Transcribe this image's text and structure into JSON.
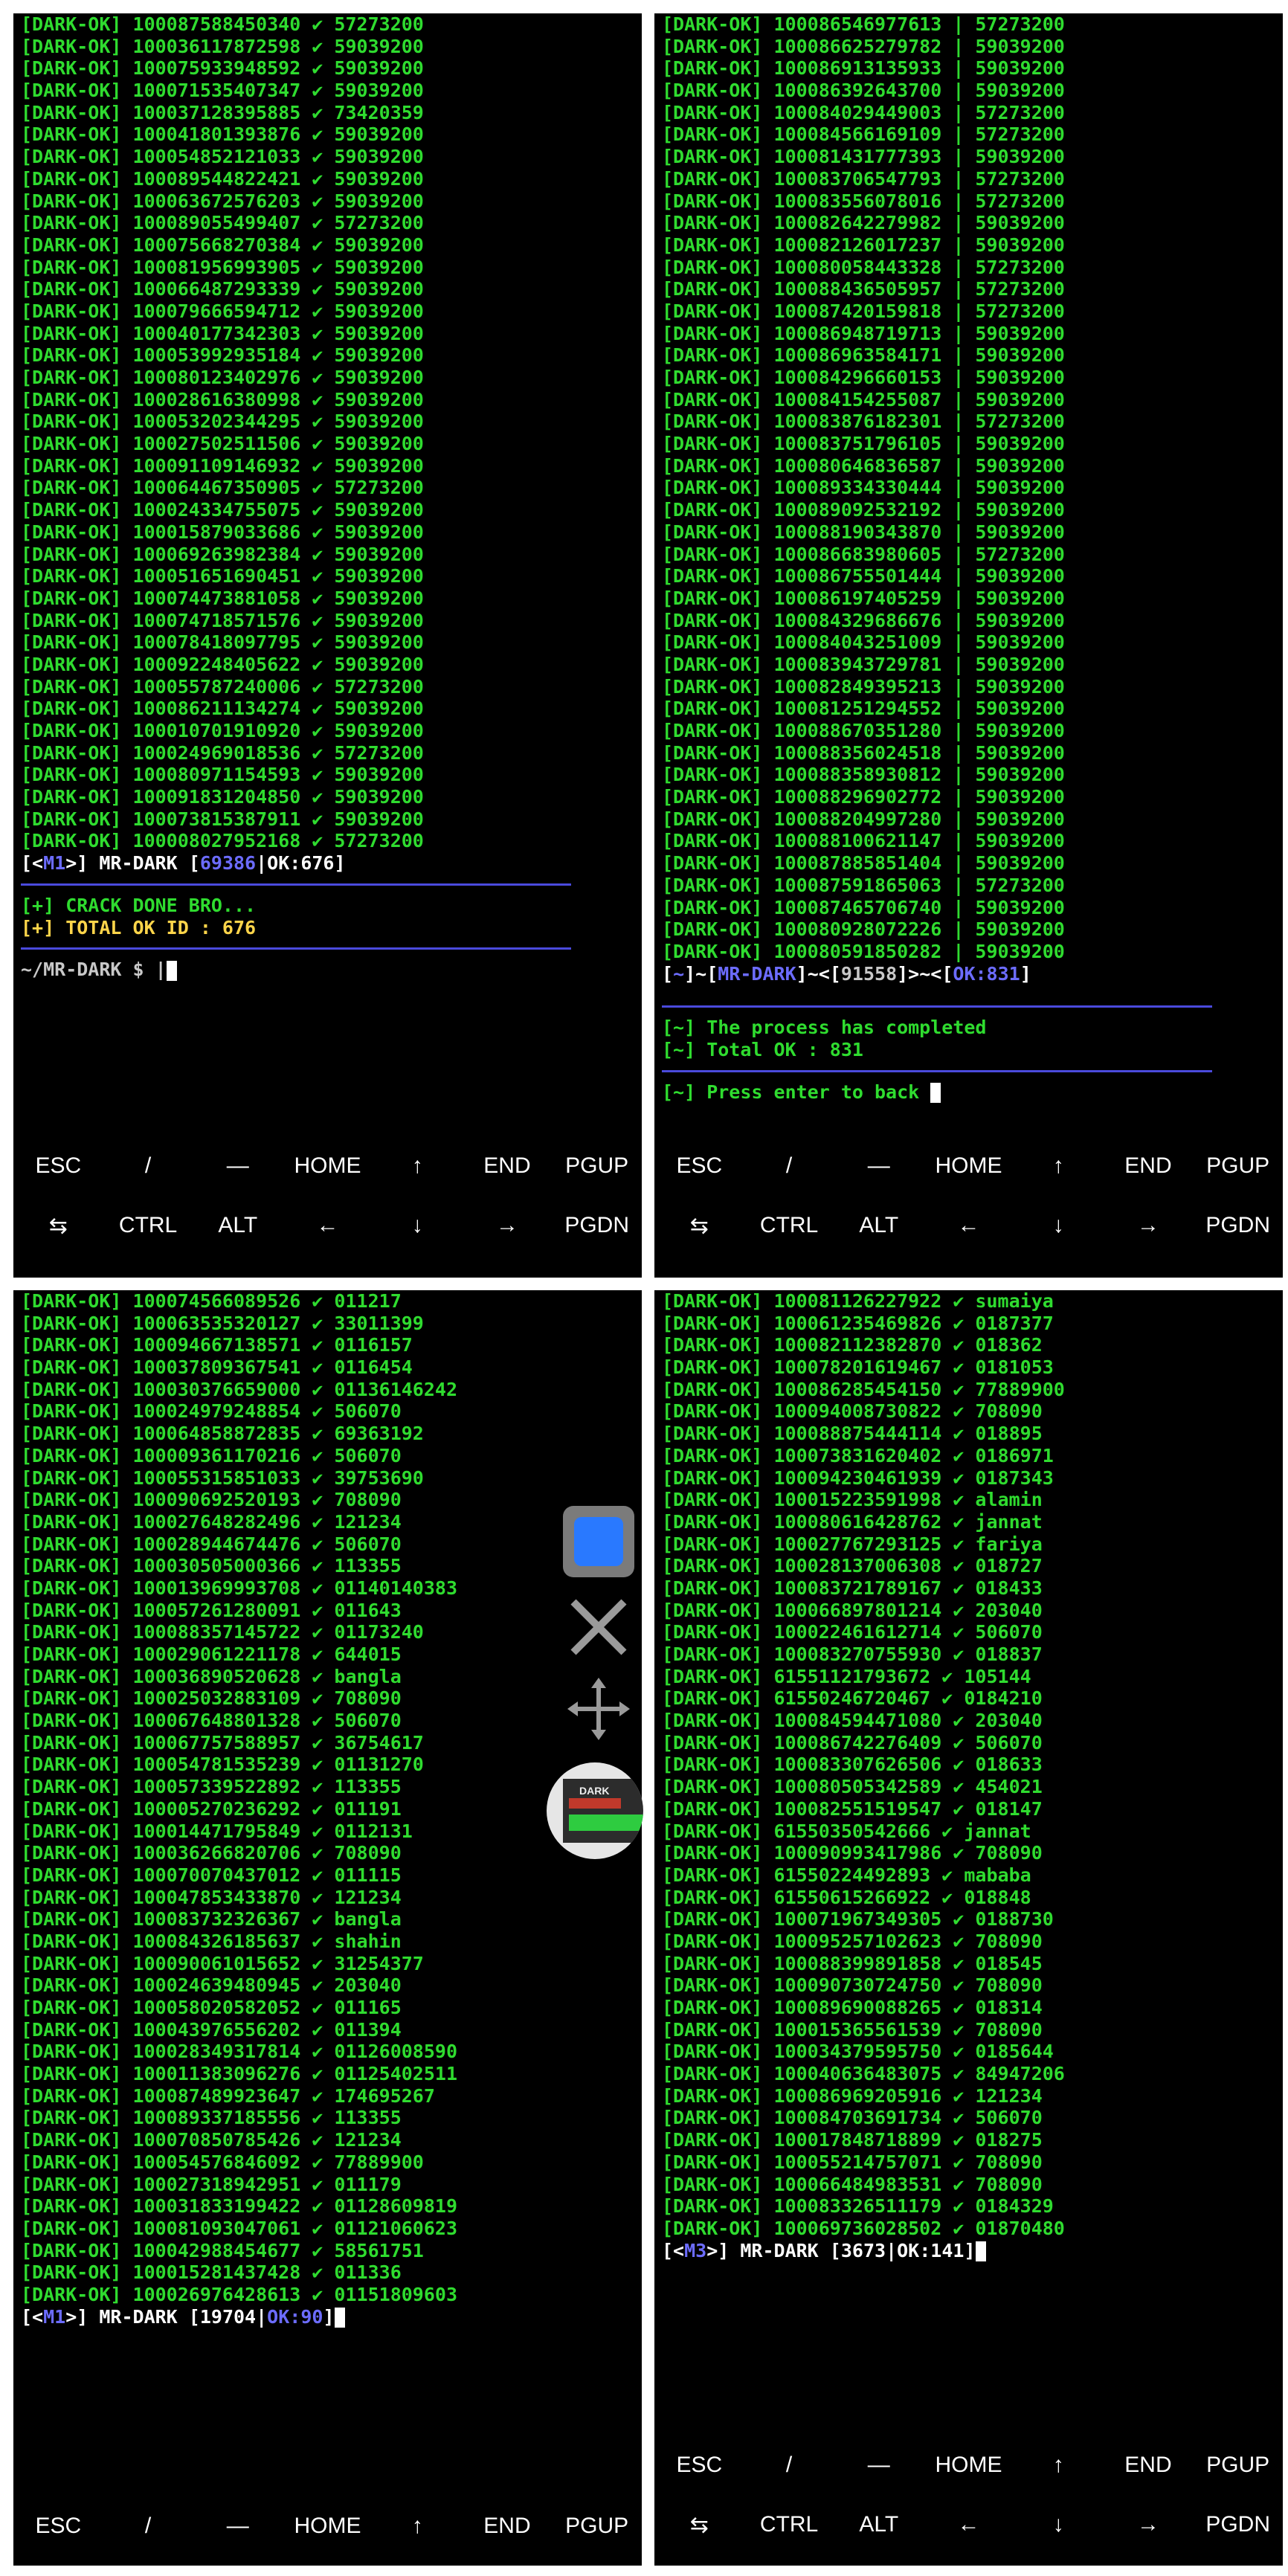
{
  "panel1": {
    "lines": [
      "[DARK-OK] 100087588450340 ✔ 57273200",
      "[DARK-OK] 100036117872598 ✔ 59039200",
      "[DARK-OK] 100075933948592 ✔ 59039200",
      "[DARK-OK] 100071535407347 ✔ 59039200",
      "[DARK-OK] 100037128395885 ✔ 73420359",
      "[DARK-OK] 100041801393876 ✔ 59039200",
      "[DARK-OK] 100054852121033 ✔ 59039200",
      "[DARK-OK] 100089544822421 ✔ 59039200",
      "[DARK-OK] 100063672576203 ✔ 59039200",
      "[DARK-OK] 100089055499407 ✔ 57273200",
      "[DARK-OK] 100075668270384 ✔ 59039200",
      "[DARK-OK] 100081956993905 ✔ 59039200",
      "[DARK-OK] 100066487293339 ✔ 59039200",
      "[DARK-OK] 100079666594712 ✔ 59039200",
      "[DARK-OK] 100040177342303 ✔ 59039200",
      "[DARK-OK] 100053992935184 ✔ 59039200",
      "[DARK-OK] 100080123402976 ✔ 59039200",
      "[DARK-OK] 100028616380998 ✔ 59039200",
      "[DARK-OK] 100053202344295 ✔ 59039200",
      "[DARK-OK] 100027502511506 ✔ 59039200",
      "[DARK-OK] 100091109146932 ✔ 59039200",
      "[DARK-OK] 100064467350905 ✔ 57273200",
      "[DARK-OK] 100024334755075 ✔ 59039200",
      "[DARK-OK] 100015879033686 ✔ 59039200",
      "[DARK-OK] 100069263982384 ✔ 59039200",
      "[DARK-OK] 100051651690451 ✔ 59039200",
      "[DARK-OK] 100074473881058 ✔ 59039200",
      "[DARK-OK] 100074718571576 ✔ 59039200",
      "[DARK-OK] 100078418097795 ✔ 59039200",
      "[DARK-OK] 100092248405622 ✔ 59039200",
      "[DARK-OK] 100055787240006 ✔ 57273200",
      "[DARK-OK] 100086211134274 ✔ 59039200",
      "[DARK-OK] 100010701910920 ✔ 59039200",
      "[DARK-OK] 100024969018536 ✔ 57273200",
      "[DARK-OK] 100080971154593 ✔ 59039200",
      "[DARK-OK] 100091831204850 ✔ 59039200",
      "[DARK-OK] 100073815387911 ✔ 59039200",
      "[DARK-OK] 100008027952168 ✔ 57273200"
    ],
    "status": {
      "prefix": "[<",
      "m": "M1",
      "mid": ">] MR-DARK [",
      "count": "69386",
      "pipe": "|",
      "ok": "OK:676",
      "end": "]"
    },
    "done1": "[+] CRACK DONE BRO...",
    "done2": "[+] TOTAL OK ID : 676",
    "prompt": "~/MR-DARK $ |"
  },
  "panel2": {
    "lines": [
      "[DARK-OK] 100086546977613 | 57273200",
      "[DARK-OK] 100086625279782 | 59039200",
      "[DARK-OK] 100086913135933 | 59039200",
      "[DARK-OK] 100086392643700 | 59039200",
      "[DARK-OK] 100084029449003 | 57273200",
      "[DARK-OK] 100084566169109 | 57273200",
      "[DARK-OK] 100081431777393 | 59039200",
      "[DARK-OK] 100083706547793 | 57273200",
      "[DARK-OK] 100083556078016 | 57273200",
      "[DARK-OK] 100082642279982 | 59039200",
      "[DARK-OK] 100082126017237 | 59039200",
      "[DARK-OK] 100080058443328 | 57273200",
      "[DARK-OK] 100088436505957 | 57273200",
      "[DARK-OK] 100087420159818 | 57273200",
      "[DARK-OK] 100086948719713 | 59039200",
      "[DARK-OK] 100086963584171 | 59039200",
      "[DARK-OK] 100084296660153 | 59039200",
      "[DARK-OK] 100084154255087 | 59039200",
      "[DARK-OK] 100083876182301 | 57273200",
      "[DARK-OK] 100083751796105 | 59039200",
      "[DARK-OK] 100080646836587 | 59039200",
      "[DARK-OK] 100089334330444 | 59039200",
      "[DARK-OK] 100089092532192 | 59039200",
      "[DARK-OK] 100088190343870 | 59039200",
      "[DARK-OK] 100086683980605 | 57273200",
      "[DARK-OK] 100086755501444 | 59039200",
      "[DARK-OK] 100086197405259 | 59039200",
      "[DARK-OK] 100084329686676 | 59039200",
      "[DARK-OK] 100084043251009 | 59039200",
      "[DARK-OK] 100083943729781 | 59039200",
      "[DARK-OK] 100082849395213 | 59039200",
      "[DARK-OK] 100081251294552 | 59039200",
      "[DARK-OK] 100088670351280 | 59039200",
      "[DARK-OK] 100088356024518 | 59039200",
      "[DARK-OK] 100088358930812 | 59039200",
      "[DARK-OK] 100088296902772 | 59039200",
      "[DARK-OK] 100088204997280 | 59039200",
      "[DARK-OK] 100088100621147 | 59039200",
      "[DARK-OK] 100087885851404 | 59039200",
      "[DARK-OK] 100087591865063 | 57273200",
      "[DARK-OK] 100087465706740 | 59039200",
      "[DARK-OK] 100080928072226 | 59039200",
      "[DARK-OK] 100080591850282 | 59039200"
    ],
    "status": {
      "a": "[",
      "b": "~",
      "c": "]~[",
      "d": "MR-DARK",
      "e": "]~<[",
      "count": "91558",
      "f": "]>~<[",
      "ok": "OK:831",
      "g": "]"
    },
    "done1": "[~] The process has completed",
    "done2": "[~] Total OK : 831",
    "prompt": "[~] Press enter to back "
  },
  "panel3": {
    "lines": [
      "[DARK-OK] 100074566089526 ✔ 011217",
      "[DARK-OK] 100063535320127 ✔ 33011399",
      "[DARK-OK] 100094667138571 ✔ 0116157",
      "[DARK-OK] 100037809367541 ✔ 0116454",
      "[DARK-OK] 100030376659000 ✔ 01136146242",
      "[DARK-OK] 100024979248854 ✔ 506070",
      "[DARK-OK] 100064858872835 ✔ 69363192",
      "[DARK-OK] 100009361170216 ✔ 506070",
      "[DARK-OK] 100055315851033 ✔ 39753690",
      "[DARK-OK] 100090692520193 ✔ 708090",
      "[DARK-OK] 100027648282496 ✔ 121234",
      "[DARK-OK] 100028944674476 ✔ 506070",
      "[DARK-OK] 100030505000366 ✔ 113355",
      "[DARK-OK] 100013969993708 ✔ 01140140383",
      "[DARK-OK] 100057261280091 ✔ 011643",
      "[DARK-OK] 100088357145722 ✔ 01173240",
      "[DARK-OK] 100029061221178 ✔ 644015",
      "[DARK-OK] 100036890520628 ✔ bangla",
      "[DARK-OK] 100025032883109 ✔ 708090",
      "[DARK-OK] 100067648801328 ✔ 506070",
      "[DARK-OK] 100067757588957 ✔ 36754617",
      "[DARK-OK] 100054781535239 ✔ 01131270",
      "[DARK-OK] 100057339522892 ✔ 113355",
      "[DARK-OK] 100005270236292 ✔ 011191",
      "[DARK-OK] 100014471795849 ✔ 0112131",
      "[DARK-OK] 100036266820706 ✔ 708090",
      "[DARK-OK] 100070070437012 ✔ 011115",
      "[DARK-OK] 100047853433870 ✔ 121234",
      "[DARK-OK] 100083732326367 ✔ bangla",
      "[DARK-OK] 100084326185637 ✔ shahin",
      "[DARK-OK] 100090061015652 ✔ 31254377",
      "[DARK-OK] 100024639480945 ✔ 203040",
      "[DARK-OK] 100058020582052 ✔ 011165",
      "[DARK-OK] 100043976556202 ✔ 011394",
      "[DARK-OK] 100028349317814 ✔ 01126008590",
      "[DARK-OK] 100011383096276 ✔ 01125402511",
      "[DARK-OK] 100087489923647 ✔ 174695267",
      "[DARK-OK] 100089337185556 ✔ 113355",
      "[DARK-OK] 100070850785426 ✔ 121234",
      "[DARK-OK] 100054576846092 ✔ 77889900",
      "[DARK-OK] 100027318942951 ✔ 011179",
      "[DARK-OK] 100031833199422 ✔ 01128609819",
      "[DARK-OK] 100081093047061 ✔ 01121060623",
      "[DARK-OK] 100042988454677 ✔ 58561751",
      "[DARK-OK] 100015281437428 ✔ 011336",
      "[DARK-OK] 100026976428613 ✔ 01151809603"
    ],
    "status": {
      "prefix": "[<",
      "m": "M1",
      "mid": ">] MR-DARK [",
      "count": "19704",
      "pipe": "|",
      "ok": "OK:90",
      "end": "]"
    }
  },
  "panel4": {
    "lines": [
      "[DARK-OK] 100081126227922 ✔ sumaiya",
      "[DARK-OK] 100061235469826 ✔ 0187377",
      "[DARK-OK] 100082112382870 ✔ 018362",
      "[DARK-OK] 100078201619467 ✔ 0181053",
      "[DARK-OK] 100086285454150 ✔ 77889900",
      "[DARK-OK] 100094008730822 ✔ 708090",
      "[DARK-OK] 100088875444114 ✔ 018895",
      "[DARK-OK] 100073831620402 ✔ 0186971",
      "[DARK-OK] 100094230461939 ✔ 0187343",
      "[DARK-OK] 100015223591998 ✔ alamin",
      "[DARK-OK] 100080616428762 ✔ jannat",
      "[DARK-OK] 100027767293125 ✔ fariya",
      "[DARK-OK] 100028137006308 ✔ 018727",
      "[DARK-OK] 100083721789167 ✔ 018433",
      "[DARK-OK] 100066897801214 ✔ 203040",
      "[DARK-OK] 100022461612714 ✔ 506070",
      "[DARK-OK] 100083270755930 ✔ 018837",
      "[DARK-OK] 61551121793672 ✔ 105144",
      "[DARK-OK] 61550246720467 ✔ 0184210",
      "[DARK-OK] 100084594471080 ✔ 203040",
      "[DARK-OK] 100086742276409 ✔ 506070",
      "[DARK-OK] 100083307626506 ✔ 018633",
      "[DARK-OK] 100080505342589 ✔ 454021",
      "[DARK-OK] 100082551519547 ✔ 018147",
      "[DARK-OK] 61550350542666 ✔ jannat",
      "[DARK-OK] 100090993417986 ✔ 708090",
      "[DARK-OK] 61550224492893 ✔ mababa",
      "[DARK-OK] 61550615266922 ✔ 018848",
      "[DARK-OK] 100071967349305 ✔ 0188730",
      "[DARK-OK] 100095257102623 ✔ 708090",
      "[DARK-OK] 100088399891858 ✔ 018545",
      "[DARK-OK] 100090730724750 ✔ 708090",
      "[DARK-OK] 100089690088265 ✔ 018314",
      "[DARK-OK] 100015365561539 ✔ 708090",
      "[DARK-OK] 100034379595750 ✔ 0185644",
      "[DARK-OK] 100040636483075 ✔ 84947206",
      "[DARK-OK] 100086969205916 ✔ 121234",
      "[DARK-OK] 100084703691734 ✔ 506070",
      "[DARK-OK] 100017848718899 ✔ 018275",
      "[DARK-OK] 100055214757071 ✔ 708090",
      "[DARK-OK] 100066484983531 ✔ 708090",
      "[DARK-OK] 100083326511179 ✔ 0184329",
      "[DARK-OK] 100069736028502 ✔ 01870480"
    ],
    "status": {
      "prefix": "[<",
      "m": "M3",
      "mid": ">] MR-DARK [",
      "count": "3673",
      "pipe": "|",
      "ok": "OK:141",
      "end": "]"
    }
  },
  "keys": {
    "row1": [
      "ESC",
      "/",
      "—",
      "HOME",
      "↑",
      "END",
      "PGUP"
    ],
    "row2": [
      "⇆",
      "CTRL",
      "ALT",
      "←",
      "↓",
      "→",
      "PGDN"
    ]
  },
  "thumb_label": "DARK",
  "colors": {
    "terminal_bg": "#000000",
    "text_green": "#2fdc2f",
    "accent_blue": "#6c6cff",
    "separator": "#4a4adc",
    "yellow": "#ffd54a"
  }
}
